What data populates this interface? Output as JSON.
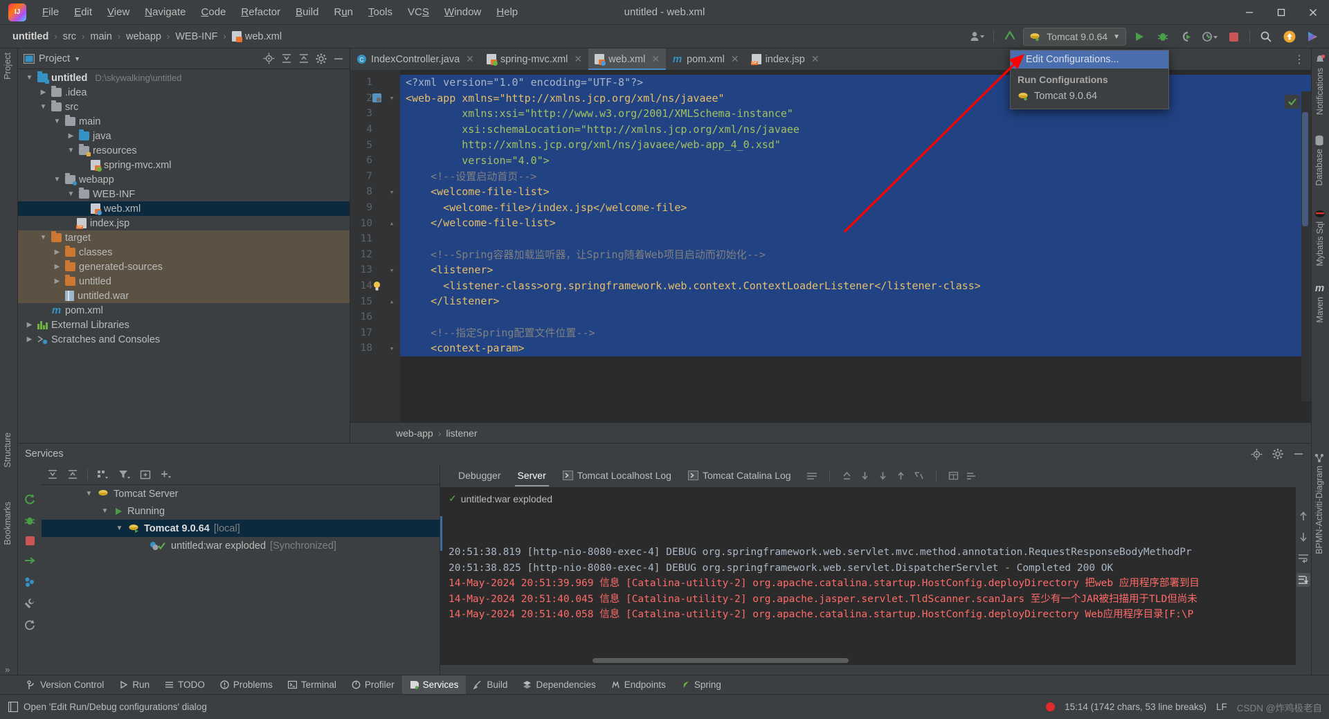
{
  "window": {
    "title": "untitled - web.xml",
    "controls": [
      "minimize",
      "maximize",
      "close"
    ]
  },
  "menu": {
    "items": [
      {
        "label": "File",
        "mnemonic": "F"
      },
      {
        "label": "Edit",
        "mnemonic": "E"
      },
      {
        "label": "View",
        "mnemonic": "V"
      },
      {
        "label": "Navigate",
        "mnemonic": "N"
      },
      {
        "label": "Code",
        "mnemonic": "C"
      },
      {
        "label": "Refactor",
        "mnemonic": "R"
      },
      {
        "label": "Build",
        "mnemonic": "B"
      },
      {
        "label": "Run",
        "mnemonic": "u"
      },
      {
        "label": "Tools",
        "mnemonic": "T"
      },
      {
        "label": "VCS",
        "mnemonic": "S"
      },
      {
        "label": "Window",
        "mnemonic": "W"
      },
      {
        "label": "Help",
        "mnemonic": "H"
      }
    ]
  },
  "breadcrumb": {
    "items": [
      "untitled",
      "src",
      "main",
      "webapp",
      "WEB-INF",
      "web.xml"
    ],
    "separator": "›"
  },
  "toolbar": {
    "run_config_label": "Tomcat 9.0.64",
    "icons": [
      "user-avatar-icon",
      "update-project-icon",
      "run-icon",
      "debug-icon",
      "run-with-coverage-icon",
      "profiler-icon",
      "stop-icon",
      "search-everywhere-icon",
      "notifications-icon",
      "ide-feature-icon"
    ]
  },
  "run_config_dropdown": {
    "edit_label": "Edit Configurations...",
    "section_header": "Run Configurations",
    "entries": [
      {
        "label": "Tomcat 9.0.64",
        "icon": "tomcat-icon"
      }
    ]
  },
  "left_tool_strip": {
    "top": [
      "Project"
    ],
    "bottom": [
      "Structure",
      "Bookmarks"
    ]
  },
  "right_tool_strip": {
    "items": [
      "Notifications",
      "Database",
      "Mybatis Sql",
      "Maven",
      "BPMN-Activiti-Diagram"
    ]
  },
  "project_panel": {
    "title": "Project",
    "header_icons": [
      "locate-icon",
      "expand-all-icon",
      "collapse-all-icon",
      "settings-gear-icon",
      "hide-icon"
    ],
    "tree": [
      {
        "label": "untitled",
        "path": "D:\\skywalking\\untitled",
        "indent": 0,
        "twist": "v",
        "icon": "module-folder-icon",
        "bold": true
      },
      {
        "label": ".idea",
        "indent": 1,
        "twist": ">",
        "icon": "folder-grey-icon"
      },
      {
        "label": "src",
        "indent": 1,
        "twist": "v",
        "icon": "folder-grey-icon"
      },
      {
        "label": "main",
        "indent": 2,
        "twist": "v",
        "icon": "folder-grey-icon"
      },
      {
        "label": "java",
        "indent": 3,
        "twist": ">",
        "icon": "source-folder-icon"
      },
      {
        "label": "resources",
        "indent": 3,
        "twist": "v",
        "icon": "resources-folder-icon"
      },
      {
        "label": "spring-mvc.xml",
        "indent": 4,
        "twist": "",
        "icon": "spring-xml-icon"
      },
      {
        "label": "webapp",
        "indent": 2,
        "twist": "v",
        "icon": "webapp-folder-icon"
      },
      {
        "label": "WEB-INF",
        "indent": 3,
        "twist": "v",
        "icon": "folder-grey-icon"
      },
      {
        "label": "web.xml",
        "indent": 4,
        "twist": "",
        "icon": "web-xml-icon",
        "selected": true
      },
      {
        "label": "index.jsp",
        "indent": 3,
        "twist": "",
        "icon": "jsp-icon"
      },
      {
        "label": "target",
        "indent": 1,
        "twist": "v",
        "icon": "folder-orange-icon",
        "excluded": true
      },
      {
        "label": "classes",
        "indent": 2,
        "twist": ">",
        "icon": "folder-orange-icon",
        "excluded": true
      },
      {
        "label": "generated-sources",
        "indent": 2,
        "twist": ">",
        "icon": "folder-orange-icon",
        "excluded": true
      },
      {
        "label": "untitled",
        "indent": 2,
        "twist": ">",
        "icon": "folder-orange-icon",
        "excluded": true
      },
      {
        "label": "untitled.war",
        "indent": 2,
        "twist": "",
        "icon": "archive-icon",
        "excluded": true
      },
      {
        "label": "pom.xml",
        "indent": 1,
        "twist": "",
        "icon": "maven-pom-icon"
      },
      {
        "label": "External Libraries",
        "indent": 0,
        "twist": ">",
        "icon": "libraries-icon"
      },
      {
        "label": "Scratches and Consoles",
        "indent": 0,
        "twist": ">",
        "icon": "scratches-icon"
      }
    ]
  },
  "editor": {
    "tabs": [
      {
        "label": "IndexController.java",
        "icon": "java-class-icon",
        "active": false
      },
      {
        "label": "spring-mvc.xml",
        "icon": "spring-xml-icon",
        "active": false
      },
      {
        "label": "web.xml",
        "icon": "web-xml-icon",
        "active": true
      },
      {
        "label": "pom.xml",
        "icon": "maven-pom-icon",
        "active": false
      },
      {
        "label": "index.jsp",
        "icon": "jsp-icon",
        "active": false
      }
    ],
    "breadcrumb": [
      "web-app",
      "listener"
    ],
    "breadcrumb_separator": "›",
    "lines": [
      {
        "n": 1,
        "text": "<?xml version=\"1.0\" encoding=\"UTF-8\"?>",
        "selected": true,
        "fold": ""
      },
      {
        "n": 2,
        "text": "<web-app xmlns=\"http://xmlns.jcp.org/xml/ns/javaee\"",
        "selected": true,
        "fold": "start",
        "gutter_icon": "xml-descriptor-icon"
      },
      {
        "n": 3,
        "text": "         xmlns:xsi=\"http://www.w3.org/2001/XMLSchema-instance\"",
        "selected": true,
        "fold": ""
      },
      {
        "n": 4,
        "text": "         xsi:schemaLocation=\"http://xmlns.jcp.org/xml/ns/javaee",
        "selected": true,
        "fold": ""
      },
      {
        "n": 5,
        "text": "         http://xmlns.jcp.org/xml/ns/javaee/web-app_4_0.xsd\"",
        "selected": true,
        "fold": ""
      },
      {
        "n": 6,
        "text": "         version=\"4.0\">",
        "selected": true,
        "fold": ""
      },
      {
        "n": 7,
        "text": "    <!--设置启动首页-->",
        "selected": true,
        "fold": "",
        "comment": true
      },
      {
        "n": 8,
        "text": "    <welcome-file-list>",
        "selected": true,
        "fold": "start"
      },
      {
        "n": 9,
        "text": "      <welcome-file>/index.jsp</welcome-file>",
        "selected": true,
        "fold": ""
      },
      {
        "n": 10,
        "text": "    </welcome-file-list>",
        "selected": true,
        "fold": "end"
      },
      {
        "n": 11,
        "text": "",
        "selected": true,
        "fold": ""
      },
      {
        "n": 12,
        "text": "    <!--Spring容器加载监听器，让Spring随着Web项目启动而初始化-->",
        "selected": true,
        "fold": "",
        "comment": true
      },
      {
        "n": 13,
        "text": "    <listener>",
        "selected": true,
        "fold": "start"
      },
      {
        "n": 14,
        "text": "      <listener-class>org.springframework.web.context.ContextLoaderListener</listener-class>",
        "selected": true,
        "fold": "",
        "gutter_icon": "intention-bulb-icon"
      },
      {
        "n": 15,
        "text": "    </listener>",
        "selected": true,
        "fold": "end"
      },
      {
        "n": 16,
        "text": "",
        "selected": true,
        "fold": ""
      },
      {
        "n": 17,
        "text": "    <!--指定Spring配置文件位置-->",
        "selected": true,
        "fold": "",
        "comment": true
      },
      {
        "n": 18,
        "text": "    <context-param>",
        "selected": true,
        "fold": "start"
      }
    ]
  },
  "services": {
    "title": "Services",
    "toolbar_icons": [
      "rerun-icon",
      "expand-all-icon",
      "collapse-all-icon",
      "group-icon",
      "filter-icon",
      "new-tab-icon",
      "add-icon"
    ],
    "run_controls": [
      "rerun-icon",
      "debug-icon",
      "stop-icon",
      "redeploy-icon",
      "settings-icon",
      "wrench-icon",
      "refresh-icon"
    ],
    "tree": [
      {
        "label": "Tomcat Server",
        "indent": 0,
        "twist": "v",
        "icon": "tomcat-icon"
      },
      {
        "label": "Running",
        "indent": 1,
        "twist": "v",
        "icon": "run-green-icon"
      },
      {
        "label": "Tomcat 9.0.64",
        "suffix": "[local]",
        "indent": 2,
        "twist": "v",
        "icon": "tomcat-run-icon",
        "selected": true,
        "bold": true
      },
      {
        "label": "untitled:war exploded",
        "suffix": "[Synchronized]",
        "indent": 3,
        "twist": "",
        "icon": "artifact-ok-icon"
      }
    ],
    "console_tabs": [
      {
        "label": "Debugger",
        "active": false,
        "icon": ""
      },
      {
        "label": "Server",
        "active": true,
        "icon": ""
      },
      {
        "label": "Tomcat Localhost Log",
        "active": false,
        "icon": "console-icon"
      },
      {
        "label": "Tomcat Catalina Log",
        "active": false,
        "icon": "console-icon"
      }
    ],
    "console_tool_icons": [
      "soft-wrap-icon",
      "scroll-to-top-icon",
      "scroll-down-icon",
      "scroll-end-icon",
      "scroll-up-icon",
      "clear-icon",
      "print-icon",
      "arrange-icon"
    ],
    "status_line": "untitled:war exploded",
    "log_lines": [
      {
        "text": "20:51:38.819 [http-nio-8080-exec-4] DEBUG org.springframework.web.servlet.mvc.method.annotation.RequestResponseBodyMethodPr",
        "error": false
      },
      {
        "text": "20:51:38.825 [http-nio-8080-exec-4] DEBUG org.springframework.web.servlet.DispatcherServlet - Completed 200 OK",
        "error": false
      },
      {
        "text": "14-May-2024 20:51:39.969 信息 [Catalina-utility-2] org.apache.catalina.startup.HostConfig.deployDirectory 把web 应用程序部署到目",
        "error": true
      },
      {
        "text": "14-May-2024 20:51:40.045 信息 [Catalina-utility-2] org.apache.jasper.servlet.TldScanner.scanJars 至少有一个JAR被扫描用于TLD但尚未",
        "error": true
      },
      {
        "text": "14-May-2024 20:51:40.058 信息 [Catalina-utility-2] org.apache.catalina.startup.HostConfig.deployDirectory Web应用程序目录[F:\\P",
        "error": true
      }
    ]
  },
  "tool_window_bar": {
    "items": [
      {
        "label": "Version Control",
        "icon": "branch-icon",
        "active": false
      },
      {
        "label": "Run",
        "icon": "run-icon",
        "active": false
      },
      {
        "label": "TODO",
        "icon": "todo-icon",
        "active": false
      },
      {
        "label": "Problems",
        "icon": "problems-icon",
        "active": false
      },
      {
        "label": "Terminal",
        "icon": "terminal-icon",
        "active": false
      },
      {
        "label": "Profiler",
        "icon": "profiler-icon",
        "active": false
      },
      {
        "label": "Services",
        "icon": "services-icon",
        "active": true
      },
      {
        "label": "Build",
        "icon": "build-icon",
        "active": false
      },
      {
        "label": "Dependencies",
        "icon": "dependencies-icon",
        "active": false
      },
      {
        "label": "Endpoints",
        "icon": "endpoints-icon",
        "active": false
      },
      {
        "label": "Spring",
        "icon": "spring-icon",
        "active": false
      }
    ]
  },
  "status_bar": {
    "message": "Open 'Edit Run/Debug configurations' dialog",
    "message_icon": "dialog-icon",
    "caret_info": "15:14 (1742 chars, 53 line breaks)",
    "line_separator": "LF",
    "watermark": "CSDN @炸鸡极老自"
  },
  "colors": {
    "accent_blue": "#4b6eaf",
    "selection_blue": "#214283",
    "panel_bg": "#3c3f41",
    "editor_bg": "#2b2b2b",
    "tree_selected": "#0d293e",
    "excluded_folder": "#5c5243",
    "error_red": "#ff6b68",
    "annotation_red": "#ff0000",
    "string_green": "#a5c261",
    "tag_yellow": "#e8bf6a"
  }
}
